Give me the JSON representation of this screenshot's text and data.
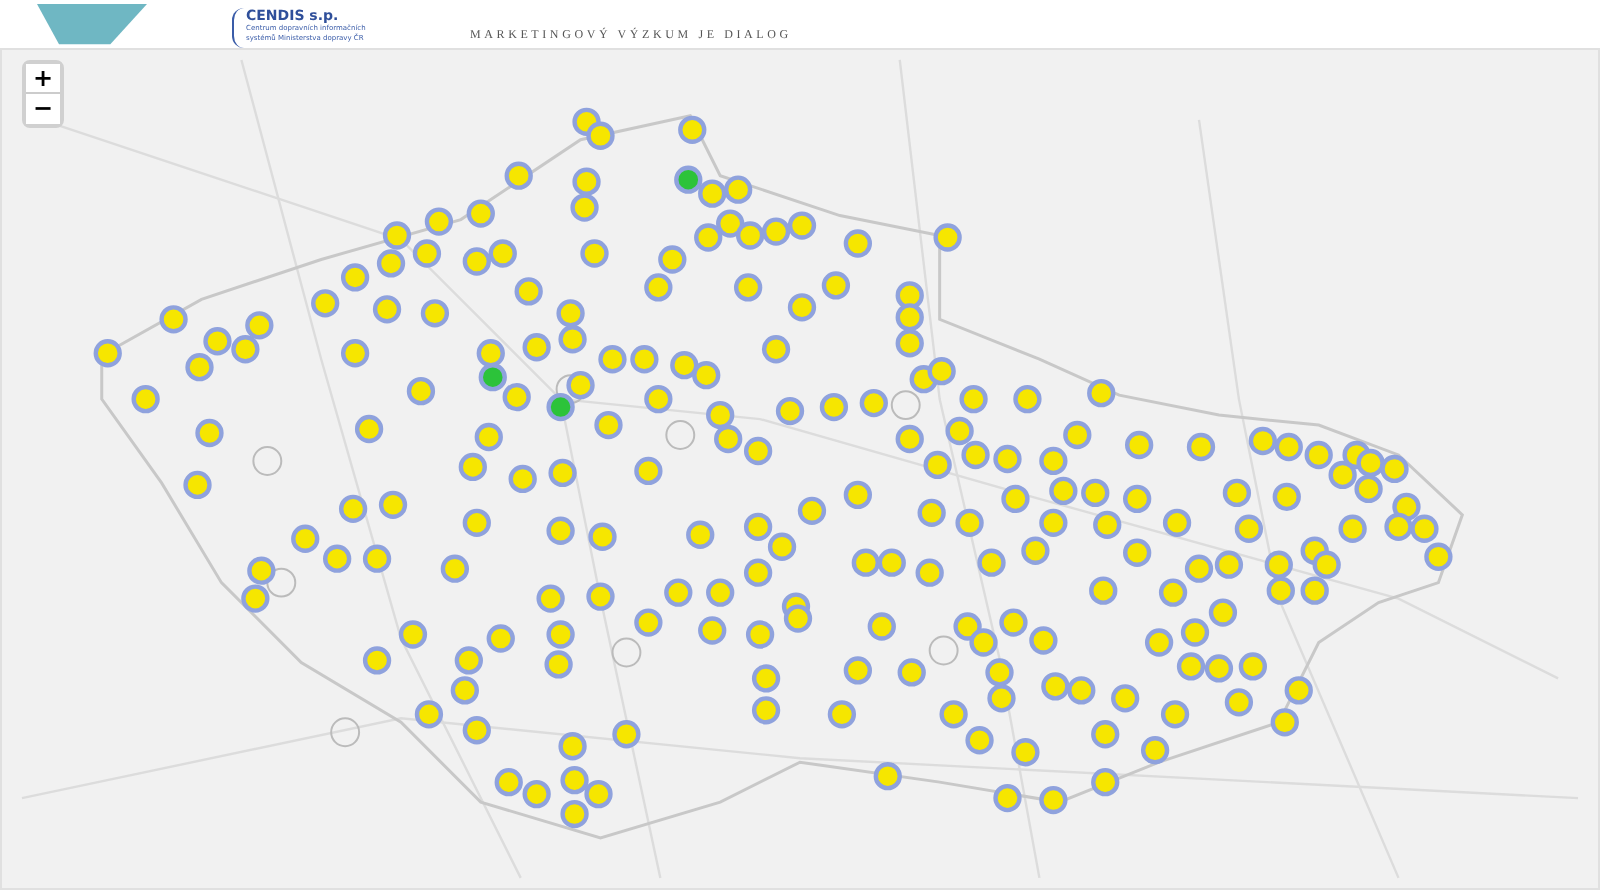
{
  "header": {
    "logo_left": {
      "name": "CENDIS s.p.",
      "subtitle": "Centrum dopravních informačních systémů Ministerstva dopravy ČR"
    },
    "logo_right": {
      "tagline": "MARKETINGOVÝ VÝZKUM JE DIALOG"
    }
  },
  "map": {
    "zoom_controls": [
      {
        "label": "+",
        "kind": "zoom-in"
      },
      {
        "label": "−",
        "kind": "zoom-out"
      }
    ]
  }
}
